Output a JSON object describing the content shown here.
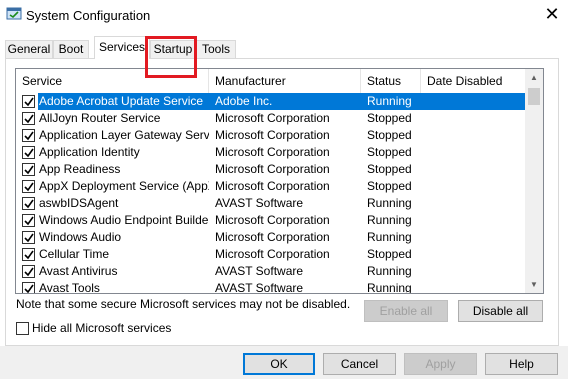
{
  "window": {
    "title": "System Configuration",
    "close_glyph": "✕",
    "icon": "msconfig-icon"
  },
  "tabs": [
    {
      "label": "General",
      "active": false
    },
    {
      "label": "Boot",
      "active": false
    },
    {
      "label": "Services",
      "active": true
    },
    {
      "label": "Startup",
      "active": false,
      "highlighted": true
    },
    {
      "label": "Tools",
      "active": false
    }
  ],
  "highlight_color": "#e21a22",
  "list": {
    "columns": [
      "Service",
      "Manufacturer",
      "Status",
      "Date Disabled"
    ],
    "rows": [
      {
        "service": "Adobe Acrobat Update Service",
        "manufacturer": "Adobe Inc.",
        "status": "Running",
        "date_disabled": "",
        "checked": true,
        "selected": true
      },
      {
        "service": "AllJoyn Router Service",
        "manufacturer": "Microsoft Corporation",
        "status": "Stopped",
        "date_disabled": "",
        "checked": true,
        "selected": false
      },
      {
        "service": "Application Layer Gateway Service",
        "manufacturer": "Microsoft Corporation",
        "status": "Stopped",
        "date_disabled": "",
        "checked": true,
        "selected": false
      },
      {
        "service": "Application Identity",
        "manufacturer": "Microsoft Corporation",
        "status": "Stopped",
        "date_disabled": "",
        "checked": true,
        "selected": false
      },
      {
        "service": "App Readiness",
        "manufacturer": "Microsoft Corporation",
        "status": "Stopped",
        "date_disabled": "",
        "checked": true,
        "selected": false
      },
      {
        "service": "AppX Deployment Service (AppX...",
        "manufacturer": "Microsoft Corporation",
        "status": "Stopped",
        "date_disabled": "",
        "checked": true,
        "selected": false
      },
      {
        "service": "aswbIDSAgent",
        "manufacturer": "AVAST Software",
        "status": "Running",
        "date_disabled": "",
        "checked": true,
        "selected": false
      },
      {
        "service": "Windows Audio Endpoint Builder",
        "manufacturer": "Microsoft Corporation",
        "status": "Running",
        "date_disabled": "",
        "checked": true,
        "selected": false
      },
      {
        "service": "Windows Audio",
        "manufacturer": "Microsoft Corporation",
        "status": "Running",
        "date_disabled": "",
        "checked": true,
        "selected": false
      },
      {
        "service": "Cellular Time",
        "manufacturer": "Microsoft Corporation",
        "status": "Stopped",
        "date_disabled": "",
        "checked": true,
        "selected": false
      },
      {
        "service": "Avast Antivirus",
        "manufacturer": "AVAST Software",
        "status": "Running",
        "date_disabled": "",
        "checked": true,
        "selected": false
      },
      {
        "service": "Avast Tools",
        "manufacturer": "AVAST Software",
        "status": "Running",
        "date_disabled": "",
        "checked": true,
        "selected": false
      }
    ],
    "selection_color": "#0078d7"
  },
  "note": "Note that some secure Microsoft services may not be disabled.",
  "buttons": {
    "enable_all": "Enable all",
    "disable_all": "Disable all",
    "ok": "OK",
    "cancel": "Cancel",
    "apply": "Apply",
    "help": "Help"
  },
  "hide_ms_services": {
    "label": "Hide all Microsoft services",
    "checked": false
  }
}
